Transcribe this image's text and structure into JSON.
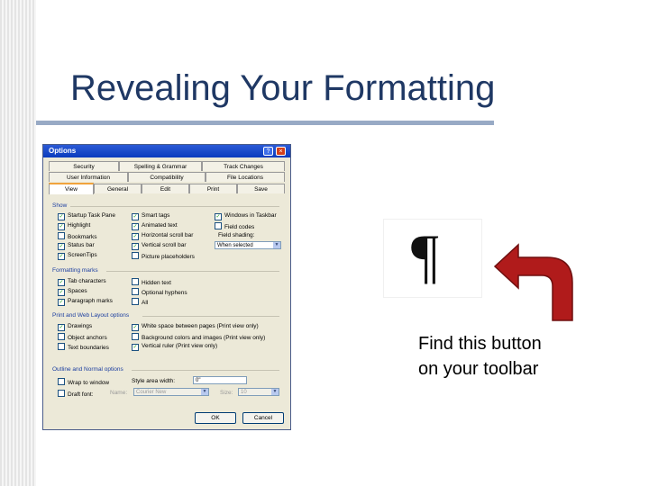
{
  "slide": {
    "title": "Revealing Your Formatting",
    "caption_line1": "Find this button",
    "caption_line2": "on your toolbar",
    "pilcrow": "¶",
    "accent_color": "#1f3864",
    "arrow_color": "#b01b1b"
  },
  "dialog": {
    "title": "Options",
    "help_symbol": "?",
    "close_symbol": "×",
    "tabs_row1": [
      "Security",
      "Spelling & Grammar",
      "Track Changes"
    ],
    "tabs_row2": [
      "User Information",
      "Compatibility",
      "File Locations"
    ],
    "tabs_row3": [
      "View",
      "General",
      "Edit",
      "Print",
      "Save"
    ],
    "show": {
      "label": "Show",
      "items": [
        {
          "label": "Startup Task Pane",
          "checked": true
        },
        {
          "label": "Highlight",
          "checked": true
        },
        {
          "label": "Bookmarks",
          "checked": false
        },
        {
          "label": "Status bar",
          "checked": true
        },
        {
          "label": "ScreenTips",
          "checked": true
        },
        {
          "label": "Smart tags",
          "checked": true
        },
        {
          "label": "Animated text",
          "checked": true
        },
        {
          "label": "Horizontal scroll bar",
          "checked": true
        },
        {
          "label": "Vertical scroll bar",
          "checked": true
        },
        {
          "label": "Picture placeholders",
          "checked": false
        },
        {
          "label": "Windows in Taskbar",
          "checked": true
        },
        {
          "label": "Field codes",
          "checked": false
        },
        {
          "label": "Field shading:",
          "checked": null
        },
        {
          "label": "When selected",
          "checked": null
        }
      ]
    },
    "formatting_marks": {
      "label": "Formatting marks",
      "items": [
        {
          "label": "Tab characters",
          "checked": true
        },
        {
          "label": "Spaces",
          "checked": true
        },
        {
          "label": "Paragraph marks",
          "checked": true
        },
        {
          "label": "Hidden text",
          "checked": false
        },
        {
          "label": "Optional hyphens",
          "checked": false
        },
        {
          "label": "All",
          "checked": false
        }
      ]
    },
    "print_web": {
      "label": "Print and Web Layout options",
      "items": [
        {
          "label": "Drawings",
          "checked": true
        },
        {
          "label": "Object anchors",
          "checked": false
        },
        {
          "label": "Text boundaries",
          "checked": false
        },
        {
          "label": "White space between pages (Print view only)",
          "checked": true
        },
        {
          "label": "Background colors and images (Print view only)",
          "checked": false
        },
        {
          "label": "Vertical ruler (Print view only)",
          "checked": true
        }
      ]
    },
    "outline": {
      "label": "Outline and Normal options",
      "wrap_label": "Wrap to window",
      "draft_label": "Draft font:",
      "style_area_label": "Style area width:",
      "style_area_value": "0\"",
      "name_label": "Name:",
      "name_value": "Courier New",
      "size_label": "Size:",
      "size_value": "10"
    },
    "ok_label": "OK",
    "cancel_label": "Cancel"
  }
}
